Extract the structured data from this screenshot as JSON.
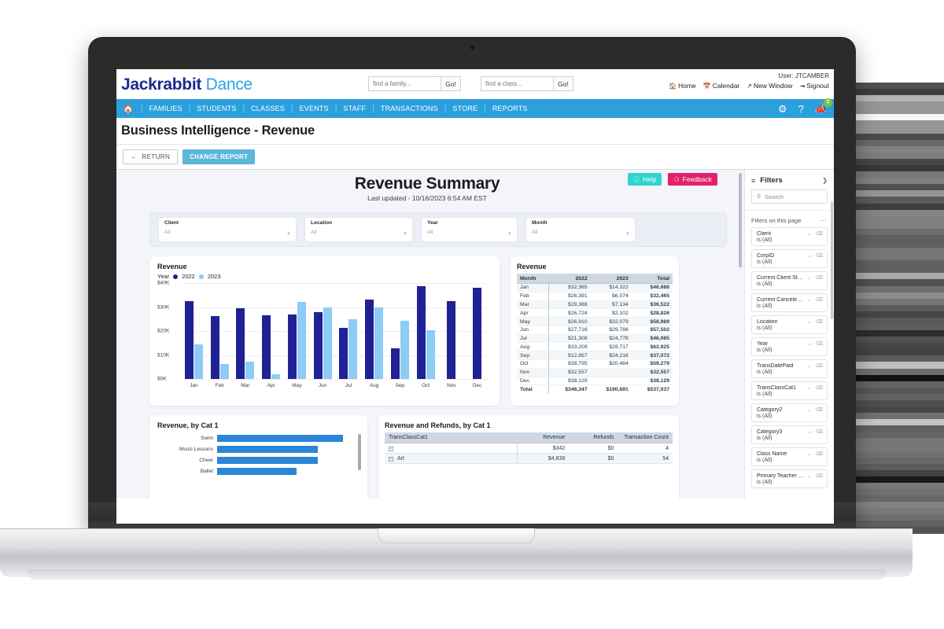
{
  "app": {
    "logo_primary": "Jackrabbit",
    "logo_secondary": "Dance"
  },
  "header": {
    "family_search_placeholder": "find a family...",
    "family_search_value": "",
    "family_go_label": "Go!",
    "class_search_placeholder": "find a class...",
    "class_search_value": "",
    "class_go_label": "Go!",
    "user_label": "User: JTCAMBER",
    "links": [
      {
        "label": "Home",
        "icon": "home-icon"
      },
      {
        "label": "Calendar",
        "icon": "calendar-icon"
      },
      {
        "label": "New Window",
        "icon": "external-link-icon"
      },
      {
        "label": "Signout",
        "icon": "signout-icon"
      }
    ]
  },
  "nav": {
    "home_icon": "home-icon",
    "items": [
      "FAMILIES",
      "STUDENTS",
      "CLASSES",
      "EVENTS",
      "STAFF",
      "TRANSACTIONS",
      "STORE",
      "REPORTS"
    ],
    "icons": [
      {
        "name": "gear-icon",
        "glyph": "⚙"
      },
      {
        "name": "help-icon",
        "glyph": "?"
      },
      {
        "name": "announcements-icon",
        "glyph": "📣",
        "badge": "2"
      }
    ],
    "badge_color": "#7ac143",
    "bar_color": "#2ba0dd"
  },
  "page": {
    "title": "Business Intelligence - Revenue",
    "return_label": "RETURN",
    "change_report_label": "CHANGE REPORT"
  },
  "dashboard": {
    "title": "Revenue Summary",
    "subtitle": "Last updated - 10/16/2023 6:54 AM EST",
    "help_label": "Help",
    "feedback_label": "Feedback",
    "help_color": "#2fd4cf",
    "feedback_color": "#e3206b",
    "slicers": [
      {
        "label": "Client",
        "value": "All"
      },
      {
        "label": "Location",
        "value": "All"
      },
      {
        "label": "Year",
        "value": "All"
      },
      {
        "label": "Month",
        "value": "All"
      }
    ],
    "chart_card_title": "Revenue",
    "legend_title": "Year",
    "table_card_title": "Revenue",
    "cat1_card_title": "Revenue, by Cat 1",
    "refunds_card_title": "Revenue and Refunds, by Cat 1"
  },
  "chart_data": [
    {
      "type": "bar",
      "title": "Revenue",
      "xlabel": "",
      "ylabel": "",
      "ylim": [
        0,
        40000
      ],
      "yticks": [
        0,
        10000,
        20000,
        30000,
        40000
      ],
      "ytick_labels": [
        "$0K",
        "$10K",
        "$20K",
        "$30K",
        "$40K"
      ],
      "grid": true,
      "legend_position": "top-left",
      "legend_title": "Year",
      "categories": [
        "Jan",
        "Feb",
        "Mar",
        "Apr",
        "May",
        "Jun",
        "Jul",
        "Aug",
        "Sep",
        "Oct",
        "Nov",
        "Dec"
      ],
      "series": [
        {
          "name": "2022",
          "color": "#202194",
          "values": [
            32365,
            26391,
            29388,
            26724,
            26910,
            27716,
            21308,
            33209,
            12857,
            38795,
            32557,
            38129
          ]
        },
        {
          "name": "2023",
          "color": "#8ecbf5",
          "values": [
            14322,
            6074,
            7134,
            2102,
            32079,
            29786,
            24778,
            29717,
            24216,
            20484,
            null,
            null
          ]
        }
      ]
    },
    {
      "type": "table",
      "title": "Revenue",
      "columns": [
        "Month",
        "2022",
        "2023",
        "Total"
      ],
      "rows": [
        [
          "Jan",
          "$32,365",
          "$14,322",
          "$46,686"
        ],
        [
          "Feb",
          "$26,391",
          "$6,074",
          "$32,465"
        ],
        [
          "Mar",
          "$29,388",
          "$7,134",
          "$36,522"
        ],
        [
          "Apr",
          "$26,724",
          "$2,102",
          "$28,826"
        ],
        [
          "May",
          "$26,910",
          "$32,079",
          "$58,989"
        ],
        [
          "Jun",
          "$27,716",
          "$29,786",
          "$57,502"
        ],
        [
          "Jul",
          "$21,308",
          "$24,778",
          "$46,085"
        ],
        [
          "Aug",
          "$33,209",
          "$29,717",
          "$62,925"
        ],
        [
          "Sep",
          "$12,857",
          "$24,216",
          "$37,072"
        ],
        [
          "Oct",
          "$38,795",
          "$20,484",
          "$59,279"
        ],
        [
          "Nov",
          "$32,557",
          "",
          "$32,557"
        ],
        [
          "Dec",
          "$38,129",
          "",
          "$38,129"
        ]
      ],
      "total_row": [
        "Total",
        "$346,347",
        "$190,691",
        "$537,037"
      ]
    },
    {
      "type": "bar",
      "orientation": "horizontal",
      "title": "Revenue, by Cat 1",
      "categories": [
        "Swim",
        "Music Lessons",
        "Cheer",
        "Ballet"
      ],
      "values": [
        100,
        80,
        80,
        63
      ],
      "color": "#2b86d8"
    },
    {
      "type": "table",
      "title": "Revenue and Refunds, by Cat 1",
      "columns": [
        "TransClassCat1",
        "Revenue",
        "Refunds",
        "Transaction Count"
      ],
      "rows": [
        [
          "",
          "$342",
          "$0",
          "4"
        ],
        [
          "Art",
          "$4,838",
          "$0",
          "54"
        ]
      ]
    }
  ],
  "filters_pane": {
    "title": "Filters",
    "filter_icon": "filter-icon",
    "expand_icon": "chevron-right-icon",
    "search_placeholder": "Search",
    "search_value": "",
    "section_label": "Filters on this page",
    "more_label": "⋯",
    "items": [
      {
        "name": "Client",
        "value": "is (All)"
      },
      {
        "name": "CorpID",
        "value": "is (All)"
      },
      {
        "name": "Current Client Status",
        "value": "is (All)"
      },
      {
        "name": "Current Canceled Date ...",
        "value": "is (All)"
      },
      {
        "name": "Location",
        "value": "is (All)"
      },
      {
        "name": "Year",
        "value": "is (All)"
      },
      {
        "name": "TransDatePaid",
        "value": "is (All)"
      },
      {
        "name": "TransClassCat1",
        "value": "is (All)"
      },
      {
        "name": "Category2",
        "value": "is (All)"
      },
      {
        "name": "Category3",
        "value": "is (All)"
      },
      {
        "name": "Class Name",
        "value": "is (All)"
      },
      {
        "name": "Primary Teacher Name",
        "value": "is (All)"
      }
    ]
  }
}
